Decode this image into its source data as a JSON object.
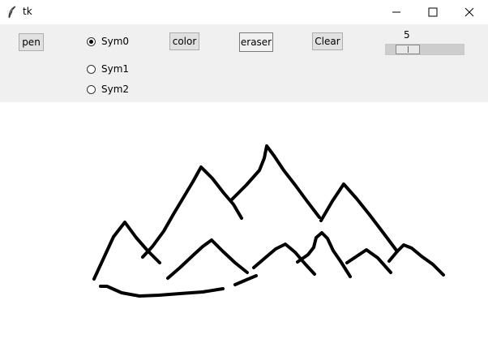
{
  "window": {
    "title": "tk"
  },
  "toolbar": {
    "pen_label": "pen",
    "color_label": "color",
    "eraser_label": "eraser",
    "clear_label": "Clear",
    "radios": [
      {
        "label": "Sym0",
        "selected": true
      },
      {
        "label": "Sym1",
        "selected": false
      },
      {
        "label": "Sym2",
        "selected": false
      }
    ],
    "scale": {
      "value": "5"
    }
  },
  "icons": {
    "app": "feather-icon",
    "minimize": "minimize-icon",
    "maximize": "maximize-icon",
    "close": "close-icon"
  }
}
